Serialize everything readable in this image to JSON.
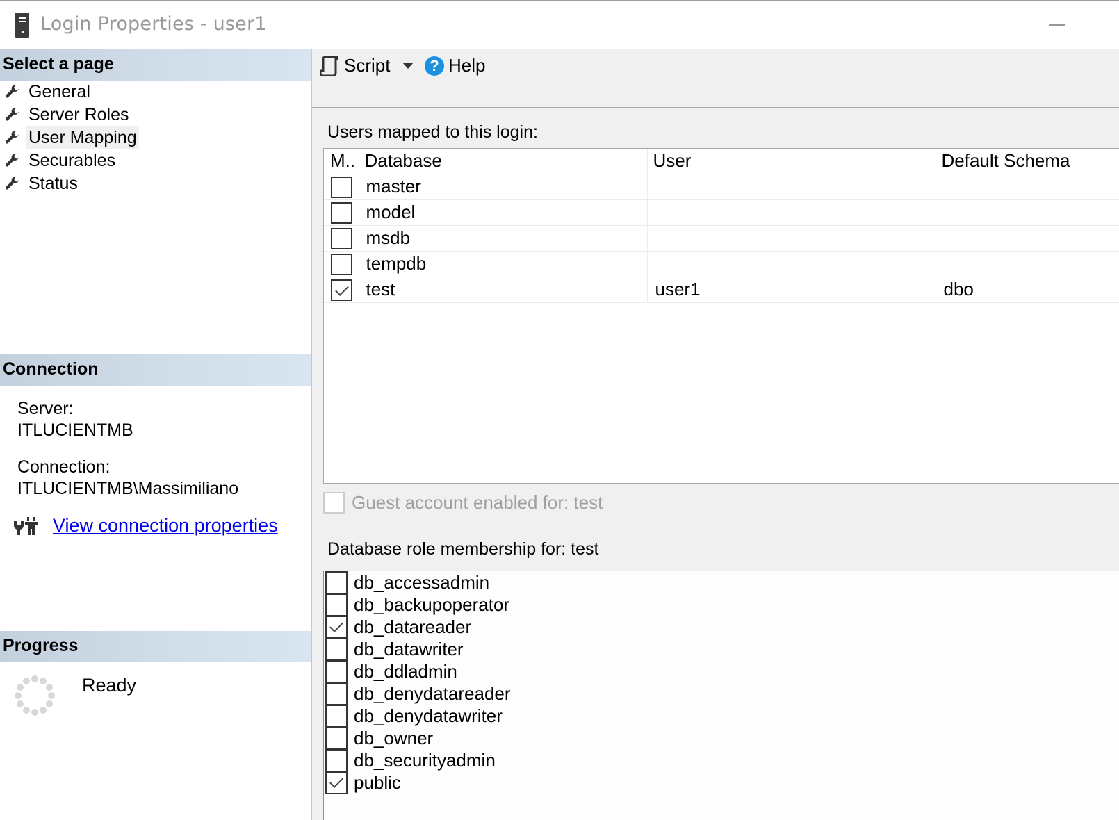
{
  "window": {
    "title": "Login Properties - user1",
    "minimize_label": "—"
  },
  "left_pane": {
    "select_page_header": "Select a page",
    "pages": [
      {
        "label": "General",
        "icon": "wrench-icon",
        "selected": false
      },
      {
        "label": "Server Roles",
        "icon": "wrench-icon",
        "selected": false
      },
      {
        "label": "User Mapping",
        "icon": "wrench-icon",
        "selected": true
      },
      {
        "label": "Securables",
        "icon": "wrench-icon",
        "selected": false
      },
      {
        "label": "Status",
        "icon": "wrench-icon",
        "selected": false
      }
    ],
    "connection_header": "Connection",
    "server_label": "Server:",
    "server_value": "ITLUCIENTMB",
    "connection_label": "Connection:",
    "connection_value": "ITLUCIENTMB\\Massimiliano",
    "view_connection_link": "View connection properties",
    "progress_header": "Progress",
    "progress_status": "Ready"
  },
  "toolbar": {
    "script_label": "Script",
    "help_label": "Help"
  },
  "user_mapping": {
    "users_mapped_label": "Users mapped to this login:",
    "columns": [
      "M..",
      "Database",
      "User",
      "Default Schema"
    ],
    "rows": [
      {
        "mapped": false,
        "database": "master",
        "user": "",
        "schema": ""
      },
      {
        "mapped": false,
        "database": "model",
        "user": "",
        "schema": ""
      },
      {
        "mapped": false,
        "database": "msdb",
        "user": "",
        "schema": ""
      },
      {
        "mapped": false,
        "database": "tempdb",
        "user": "",
        "schema": ""
      },
      {
        "mapped": true,
        "database": "test",
        "user": "user1",
        "schema": "dbo"
      }
    ],
    "guest_label": "Guest account enabled for: test",
    "guest_enabled": false,
    "role_membership_label": "Database role membership for: test",
    "roles": [
      {
        "name": "db_accessadmin",
        "checked": false
      },
      {
        "name": "db_backupoperator",
        "checked": false
      },
      {
        "name": "db_datareader",
        "checked": true
      },
      {
        "name": "db_datawriter",
        "checked": false
      },
      {
        "name": "db_ddladmin",
        "checked": false
      },
      {
        "name": "db_denydatareader",
        "checked": false
      },
      {
        "name": "db_denydatawriter",
        "checked": false
      },
      {
        "name": "db_owner",
        "checked": false
      },
      {
        "name": "db_securityadmin",
        "checked": false
      },
      {
        "name": "public",
        "checked": true
      }
    ]
  },
  "colors": {
    "link": "#0000ee",
    "help_icon": "#1e90e0",
    "section_header": "#c3d0dd",
    "pane_background": "#f0f0f0"
  }
}
